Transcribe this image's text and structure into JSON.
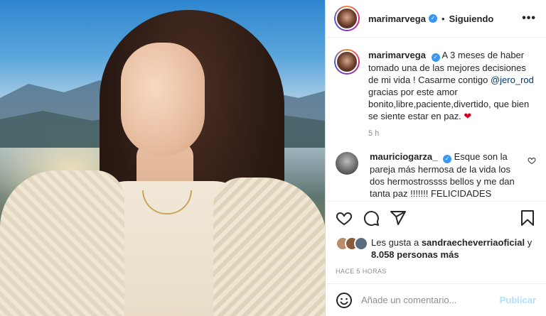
{
  "post": {
    "photo_alt": "",
    "author": {
      "username": "marimarvega",
      "verified": true,
      "follow_status": "Siguiendo"
    },
    "caption": {
      "username": "marimarvega",
      "text_before": "A 3 meses de haber tomado una de las mejores decisiones de mi vida ! Casarme contigo ",
      "mention": "@jero_rod",
      "text_after": " gracias por este amor bonito,libre,paciente,divertido, que bien se siente estar en paz. ",
      "emoji": "❤",
      "time": "5 h"
    },
    "comments": [
      {
        "username": "mauriciogarza_",
        "verified": true,
        "text": "Esque son la pareja más hermosa de la vida los dos hermostrossss bellos y me dan tanta paz !!!!!!! FELICIDADES"
      }
    ],
    "likes": {
      "prefix": "Les gusta a ",
      "user": "sandraecheverriaoficial",
      "conjunction": " y",
      "count_text": "8.058 personas más"
    },
    "posted_ago": "HACE 5 HORAS",
    "comment_input": {
      "placeholder": "Añade un comentario...",
      "publish_label": "Publicar"
    }
  },
  "colors": {
    "verified_blue": "#3897f0",
    "link_blue": "#00376b",
    "publish_disabled": "#b2dffc",
    "heart_red": "#d4001c"
  }
}
